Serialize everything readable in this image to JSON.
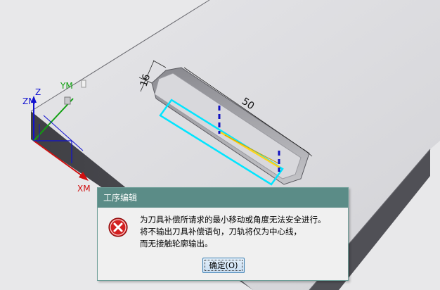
{
  "viewport": {
    "labels": {
      "z": "Z",
      "zm": "ZM",
      "ym": "YM",
      "xm": "XM"
    },
    "dimensions": {
      "width": "16",
      "length": "50"
    },
    "colors": {
      "top_face": "#dcdcdf",
      "side_face": "#4a4a4f",
      "toolpath": "#00e5ff",
      "tool_line": "#ffd21f",
      "dim_line": "#1010c0"
    }
  },
  "dialog": {
    "title": "工序编辑",
    "icon": "error-icon",
    "message_lines": [
      "为刀具补偿所请求的最小移动或角度无法安全进行。",
      "将不输出刀具补偿语句，刀轨将仅为中心线，",
      "而无接触轮廓输出。"
    ],
    "ok_label": "确定(O)"
  }
}
